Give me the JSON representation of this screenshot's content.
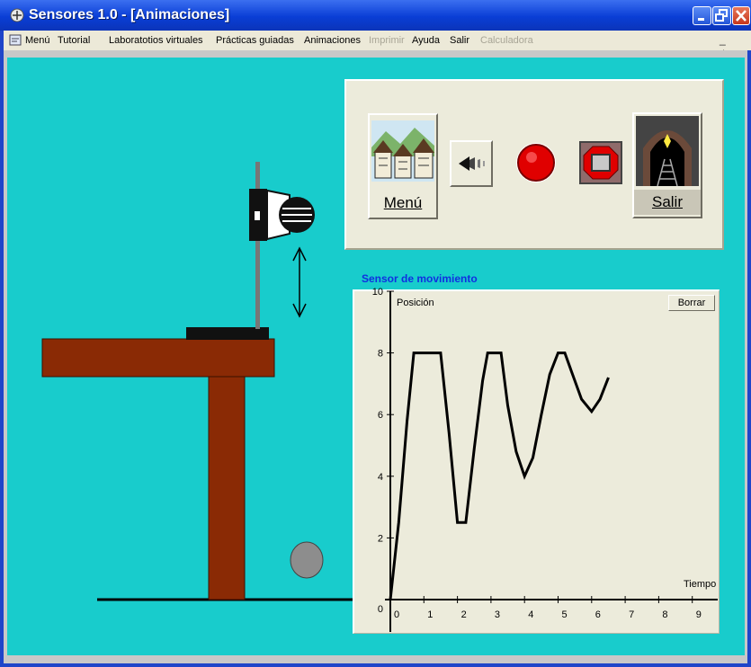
{
  "window": {
    "title": "Sensores 1.0 - [Animaciones]",
    "mdi_controls": "_ ♁ ×"
  },
  "menu": {
    "items": [
      {
        "label": "Menú",
        "enabled": true
      },
      {
        "label": "Tutorial",
        "enabled": true
      },
      {
        "label": "Laboratotios virtuales",
        "enabled": true
      },
      {
        "label": "Prácticas guiadas",
        "enabled": true
      },
      {
        "label": "Animaciones",
        "enabled": true
      },
      {
        "label": "Imprimir",
        "enabled": false
      },
      {
        "label": "Ayuda",
        "enabled": true
      },
      {
        "label": "Salir",
        "enabled": true
      },
      {
        "label": "Calculadora",
        "enabled": false
      }
    ]
  },
  "toolbar": {
    "menu_label": "Menú",
    "exit_label": "Salir",
    "back_icon": "back-arrow-icon",
    "record_icon": "record-icon",
    "stop_icon": "stop-icon"
  },
  "chart_panel": {
    "title": "Sensor de movimiento",
    "clear_label": "Borrar"
  },
  "colors": {
    "background": "#18cccc",
    "table": "#8a2a05",
    "panel": "#ecebdb",
    "chart_title": "#1030e0"
  },
  "chart_data": {
    "type": "line",
    "title": "Sensor de movimiento",
    "xlabel": "Tiempo",
    "ylabel": "Posición",
    "xlim": [
      0,
      9
    ],
    "ylim": [
      0,
      10
    ],
    "x_ticks": [
      "0",
      "1",
      "2",
      "3",
      "4",
      "5",
      "6",
      "7",
      "8",
      "9"
    ],
    "y_ticks": [
      "0",
      "2",
      "4",
      "6",
      "8",
      "10"
    ],
    "series": [
      {
        "x": [
          0,
          0.25,
          0.5,
          0.7,
          1.5,
          1.75,
          2.0,
          2.25,
          2.5,
          2.75,
          2.9,
          3.3,
          3.5,
          3.75,
          4.0,
          4.25,
          4.5,
          4.75,
          5.0,
          5.2,
          5.4,
          5.7,
          6.0,
          6.25,
          6.5
        ],
        "y": [
          0,
          2.5,
          5.8,
          8,
          8,
          5.4,
          2.5,
          2.5,
          4.9,
          7.1,
          8,
          8,
          6.3,
          4.8,
          4.0,
          4.6,
          6.0,
          7.3,
          8,
          8,
          7.4,
          6.5,
          6.1,
          6.5,
          7.2
        ]
      }
    ],
    "grid": false
  }
}
